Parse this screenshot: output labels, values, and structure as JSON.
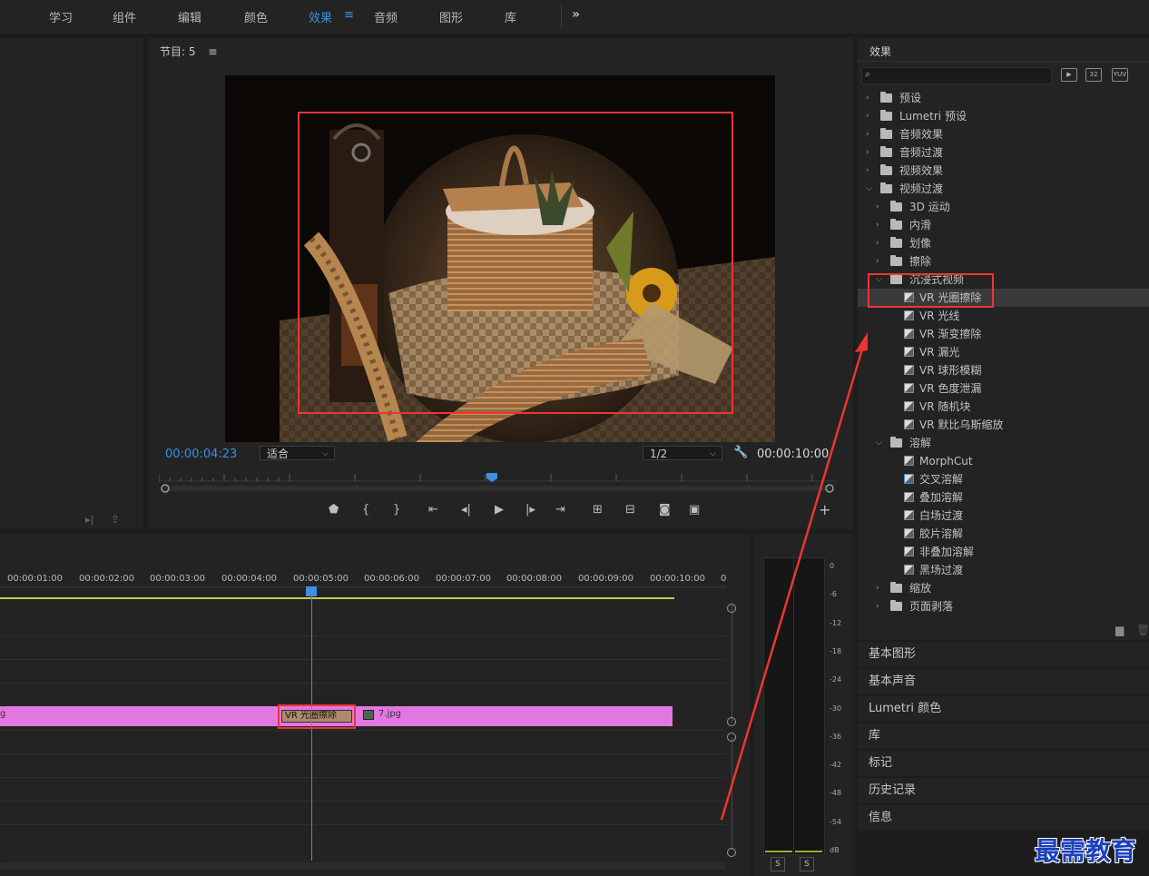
{
  "nav": {
    "items": [
      "学习",
      "组件",
      "编辑",
      "颜色",
      "效果",
      "音频",
      "图形",
      "库"
    ],
    "active_index": 4,
    "more_icon": "double-chevron-right"
  },
  "program": {
    "title": "节目: 5",
    "menu_icon": "hamburger",
    "timecode_current": "00:00:04:23",
    "fit_value": "适合",
    "resolution_value": "1/2",
    "timecode_duration": "00:00:10:00",
    "settings_icon": "wrench"
  },
  "effects": {
    "title": "效果",
    "search_placeholder": "",
    "badges": [
      "32",
      "YUV"
    ],
    "tree": [
      {
        "label": "预设",
        "type": "folder-star",
        "level": 0,
        "expanded": false
      },
      {
        "label": "Lumetri 预设",
        "type": "folder-star",
        "level": 0,
        "expanded": false
      },
      {
        "label": "音频效果",
        "type": "folder",
        "level": 0,
        "expanded": false
      },
      {
        "label": "音频过渡",
        "type": "folder",
        "level": 0,
        "expanded": false
      },
      {
        "label": "视频效果",
        "type": "folder",
        "level": 0,
        "expanded": false
      },
      {
        "label": "视频过渡",
        "type": "folder",
        "level": 0,
        "expanded": true
      },
      {
        "label": "3D 运动",
        "type": "folder",
        "level": 1,
        "expanded": false
      },
      {
        "label": "内滑",
        "type": "folder",
        "level": 1,
        "expanded": false
      },
      {
        "label": "划像",
        "type": "folder",
        "level": 1,
        "expanded": false
      },
      {
        "label": "擦除",
        "type": "folder",
        "level": 1,
        "expanded": false
      },
      {
        "label": "沉浸式视频",
        "type": "folder",
        "level": 1,
        "expanded": true
      },
      {
        "label": "VR 光圈擦除",
        "type": "item",
        "level": 2,
        "selected": true
      },
      {
        "label": "VR 光线",
        "type": "item",
        "level": 2
      },
      {
        "label": "VR 渐变擦除",
        "type": "item",
        "level": 2
      },
      {
        "label": "VR 漏光",
        "type": "item",
        "level": 2
      },
      {
        "label": "VR 球形模糊",
        "type": "item",
        "level": 2
      },
      {
        "label": "VR 色度泄漏",
        "type": "item",
        "level": 2
      },
      {
        "label": "VR 随机块",
        "type": "item",
        "level": 2
      },
      {
        "label": "VR 默比乌斯缩放",
        "type": "item",
        "level": 2
      },
      {
        "label": "溶解",
        "type": "folder",
        "level": 1,
        "expanded": true
      },
      {
        "label": "MorphCut",
        "type": "item",
        "level": 2
      },
      {
        "label": "交叉溶解",
        "type": "item",
        "level": 2,
        "default": true
      },
      {
        "label": "叠加溶解",
        "type": "item",
        "level": 2
      },
      {
        "label": "白场过渡",
        "type": "item",
        "level": 2
      },
      {
        "label": "胶片溶解",
        "type": "item",
        "level": 2
      },
      {
        "label": "非叠加溶解",
        "type": "item",
        "level": 2
      },
      {
        "label": "黑场过渡",
        "type": "item",
        "level": 2
      },
      {
        "label": "缩放",
        "type": "folder",
        "level": 1,
        "expanded": false
      },
      {
        "label": "页面剥落",
        "type": "folder",
        "level": 1,
        "expanded": false
      }
    ]
  },
  "collapsed_panels": [
    "基本图形",
    "基本声音",
    "Lumetri 颜色",
    "库",
    "标记",
    "历史记录",
    "信息"
  ],
  "timeline": {
    "times": [
      "00:00:01:00",
      "00:00:02:00",
      "00:00:03:00",
      "00:00:04:00",
      "00:00:05:00",
      "00:00:06:00",
      "00:00:07:00",
      "00:00:08:00",
      "00:00:09:00",
      "00:00:10:00",
      "0"
    ],
    "clip_left_label": "g",
    "transition_label": "VR 光圈擦除",
    "clip_label": "7.jpg",
    "clip_color": "#e277e1",
    "playhead_color": "#3d8fe0"
  },
  "meter": {
    "db_labels": [
      "0",
      "-6",
      "-12",
      "-18",
      "-24",
      "-30",
      "-36",
      "-42",
      "-48",
      "-54",
      "dB"
    ],
    "solo_labels": [
      "S",
      "S"
    ]
  },
  "watermark": "最需教育",
  "colors": {
    "accent": "#3d8fe0",
    "highlight_red": "#ee3434"
  }
}
